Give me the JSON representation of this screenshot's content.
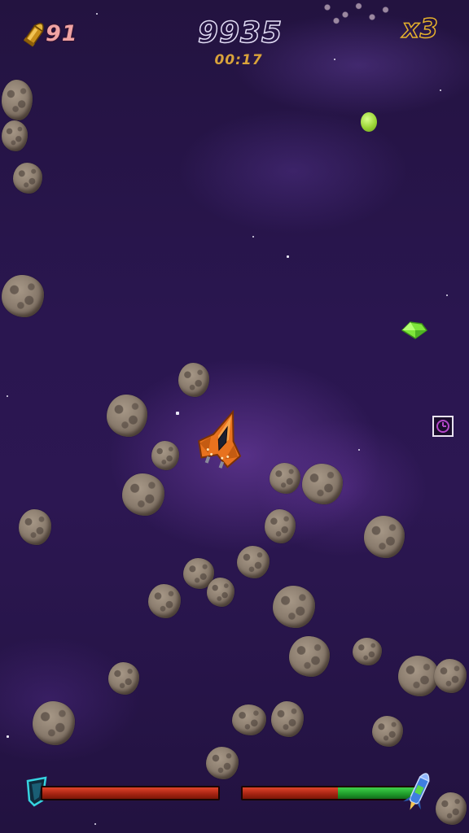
{
  "hud": {
    "ammo_count": "91",
    "score": "9935",
    "timer": "00:17",
    "multiplier": "x3"
  },
  "icons": {
    "ammo": "bullet-icon",
    "shield": "shield-icon",
    "boost": "rocket-icon",
    "pickup_target": "clock-target-icon",
    "gem": "green-gem-icon",
    "orb": "green-orb-icon",
    "ship": "player-ship"
  },
  "bars": {
    "health_fill": 1.0,
    "boost_red_fraction": 0.55,
    "boost_green_fraction": 0.45
  },
  "colors": {
    "ammo_text": "#f0a3a3",
    "score_text": "#e2ddf5",
    "timer_text": "#d9a33a",
    "multiplier_text": "#e6b22c",
    "bar_red": "#a32311",
    "bar_green": "#1f9a2a"
  }
}
